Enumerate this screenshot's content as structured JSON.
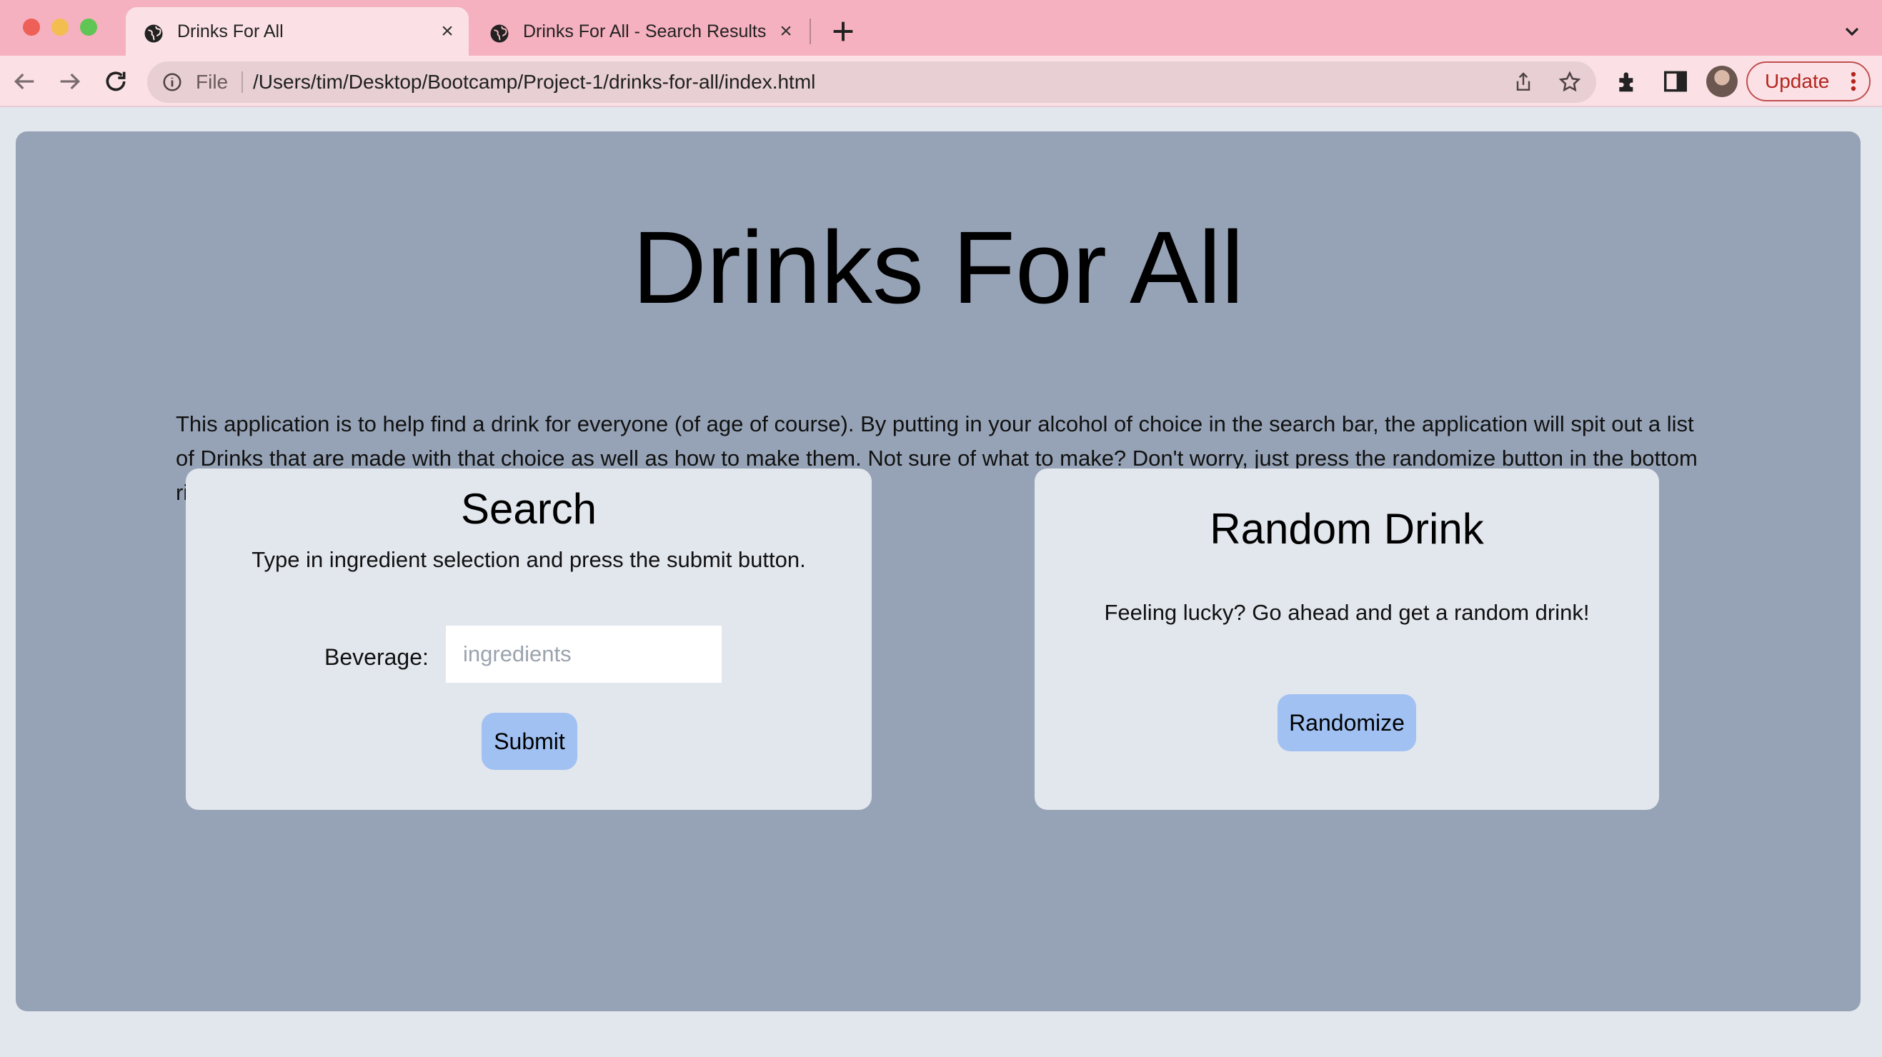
{
  "browser": {
    "tabs": [
      {
        "title": "Drinks For All",
        "active": true
      },
      {
        "title": "Drinks For All - Search Results",
        "active": false
      }
    ],
    "address_scheme": "File",
    "address_path": "/Users/tim/Desktop/Bootcamp/Project-1/drinks-for-all/index.html",
    "update_label": "Update"
  },
  "page": {
    "title": "Drinks For All",
    "description": "This application is to help find a drink for everyone (of age of course). By putting in your alcohol of choice in the search bar, the application will spit out a list of Drinks that are made with that choice as well as how to make them. Not sure of what to make? Don't worry, just press the randomize button in the bottom right to have our app randomly select a drink for you!",
    "search": {
      "heading": "Search",
      "instructions": "Type in ingredient selection and press the submit button.",
      "field_label": "Beverage:",
      "placeholder": "ingredients",
      "value": "",
      "submit_label": "Submit"
    },
    "random": {
      "heading": "Random Drink",
      "text": "Feeling lucky? Go ahead and get a random drink!",
      "button_label": "Randomize"
    }
  },
  "colors": {
    "tabbar": "#f5b1bf",
    "toolbar": "#fbe1e6",
    "hero": "#96a3b6",
    "card": "#e2e6ed",
    "button": "#a0c1f2"
  }
}
